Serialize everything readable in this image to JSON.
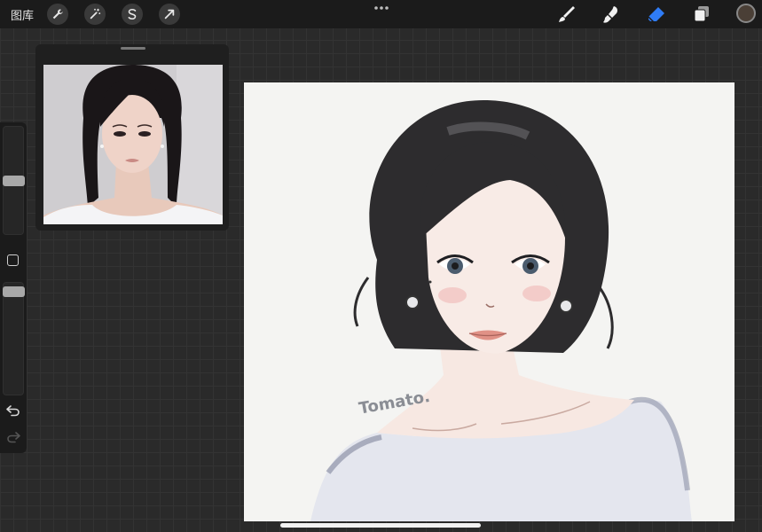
{
  "topbar": {
    "gallery_label": "图库",
    "tools_left": [
      "wrench-icon",
      "magic-wand-icon",
      "selection-s-icon",
      "transform-arrow-icon"
    ],
    "tools_right": [
      "brush-icon",
      "smudge-icon",
      "eraser-icon",
      "layers-icon"
    ],
    "active_tool": "eraser",
    "accent_color": "#2f7cf6",
    "current_color": "#4a3f36"
  },
  "sidebar": {
    "brush_size_level": 0.5,
    "opacity_level": 0.15
  },
  "canvas": {
    "signature": "Tomato."
  }
}
